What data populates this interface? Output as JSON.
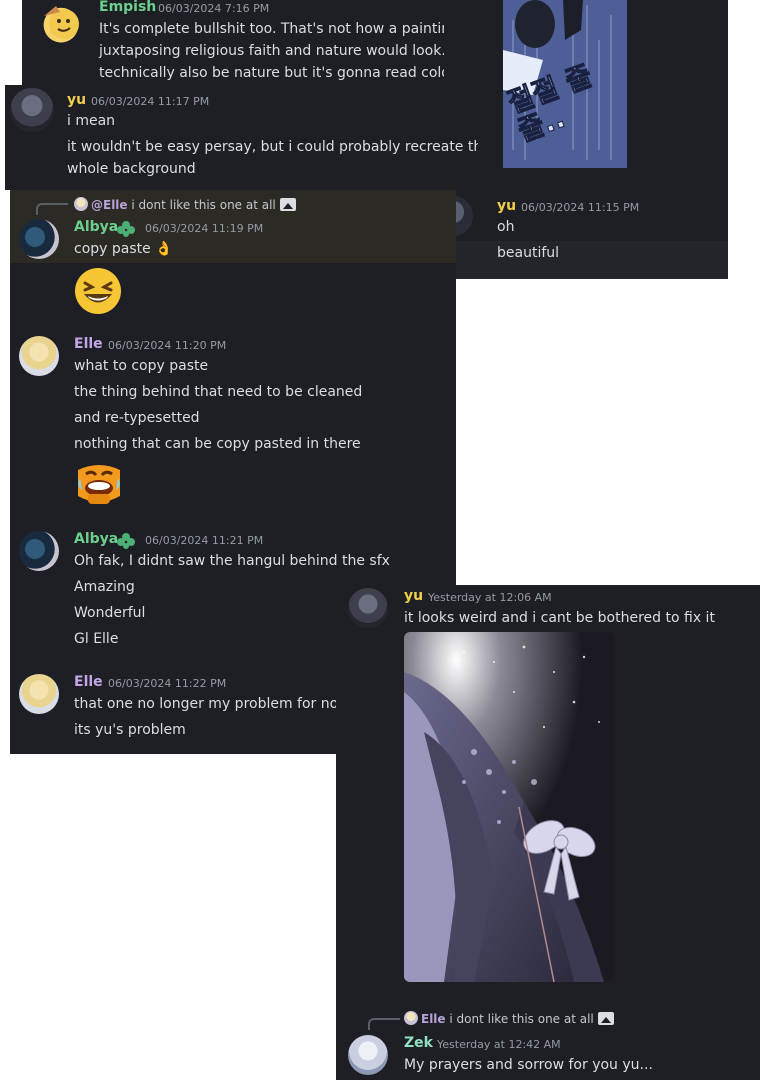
{
  "colors": {
    "panel_bg": "#1e1f24",
    "reply_highlight": "#2c2a25",
    "hover_row": "#23252a",
    "user_green": "#6ccf8e",
    "user_yellow": "#f0cf4b",
    "user_purple": "#c3a6e8",
    "user_teal": "#8fe3c4",
    "timestamp": "#949ba4",
    "text": "#dbdee1"
  },
  "top_right_panel": {
    "image_text": "절절 줄줄..",
    "message": {
      "author": "yu",
      "timestamp": "06/03/2024 11:15 PM",
      "lines": [
        "oh",
        "beautiful"
      ]
    }
  },
  "empish_panel": {
    "author": "Empish",
    "timestamp": "06/03/2024 7:16 PM",
    "lines": [
      "It's complete bullshit too. That's not how a painting",
      "juxtaposing religious faith and nature would look. S",
      "technically also be nature but it's gonna read cold,"
    ]
  },
  "yu_panel": {
    "author": "yu",
    "timestamp": "06/03/2024 11:17 PM",
    "lines": [
      "i mean",
      "it wouldn't be easy persay, but i could probably recreate that",
      "whole background"
    ]
  },
  "main_panel": {
    "reply1": {
      "mention": "@Elle",
      "text": "i dont like this one at all"
    },
    "albya1": {
      "author": "Albya",
      "timestamp": "06/03/2024 11:19 PM",
      "lines": [
        "copy paste 👌"
      ],
      "emoji": "laughing-emoji"
    },
    "elle1": {
      "author": "Elle",
      "timestamp": "06/03/2024 11:20 PM",
      "lines": [
        "what to copy paste",
        "the thing behind that need to be cleaned",
        "and re-typesetted",
        "nothing that can be copy pasted in there"
      ],
      "emoji": "sob-laugh-emoji"
    },
    "albya2": {
      "author": "Albya",
      "timestamp": "06/03/2024 11:21 PM",
      "lines": [
        "Oh fak, I didnt saw the hangul behind the sfx",
        "Amazing",
        "Wonderful",
        "Gl Elle"
      ]
    },
    "elle2": {
      "author": "Elle",
      "timestamp": "06/03/2024 11:22 PM",
      "lines": [
        "that one no longer my problem for now",
        "its yu's problem"
      ]
    }
  },
  "bottom_panel": {
    "yu": {
      "author": "yu",
      "timestamp": "Yesterday at 12:06 AM",
      "lines": [
        "it looks weird and i cant be bothered to fix it"
      ]
    },
    "reply": {
      "mention": "Elle",
      "text": "i dont like this one at all"
    },
    "zek": {
      "author": "Zek",
      "timestamp": "Yesterday at 12:42 AM",
      "lines": [
        "My prayers and sorrow for you yu..."
      ]
    }
  }
}
